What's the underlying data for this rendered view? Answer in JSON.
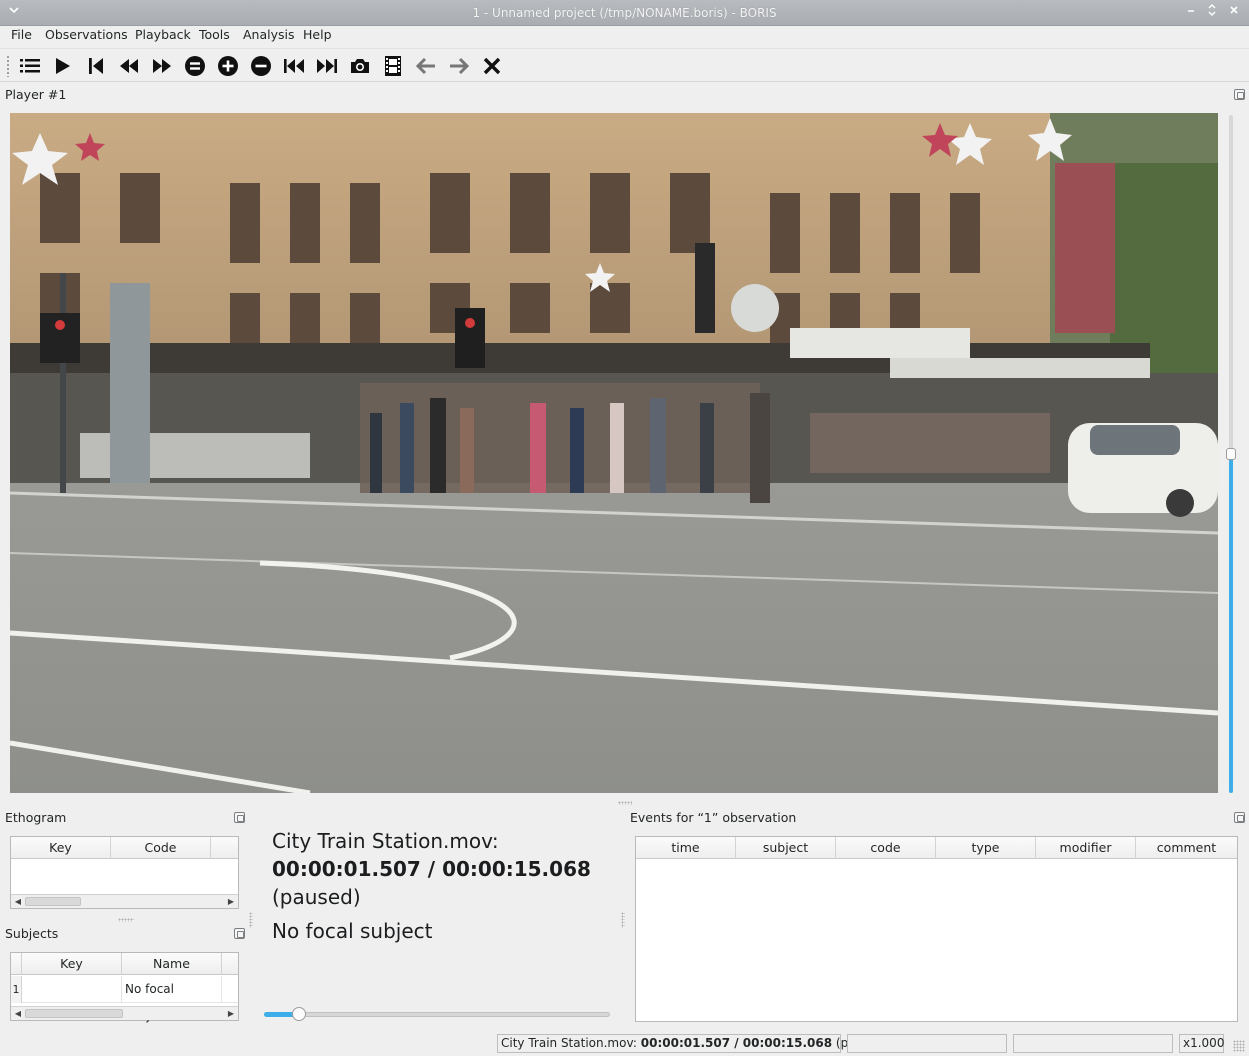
{
  "window": {
    "title": "1 - Unnamed project (/tmp/NONAME.boris) - BORIS",
    "menu_icon": "chevron-down-icon",
    "controls": [
      "minimize-icon",
      "maximize-icon",
      "close-icon"
    ]
  },
  "menu": [
    "File",
    "Observations",
    "Playback",
    "Tools",
    "Analysis",
    "Help"
  ],
  "toolbar": {
    "buttons": [
      {
        "name": "list-icon"
      },
      {
        "name": "play-icon"
      },
      {
        "name": "skip-to-start-icon"
      },
      {
        "name": "rewind-icon"
      },
      {
        "name": "fast-forward-icon"
      },
      {
        "name": "reset-speed-icon"
      },
      {
        "name": "zoom-in-plus-icon"
      },
      {
        "name": "zoom-out-minus-icon"
      },
      {
        "name": "previous-media-icon"
      },
      {
        "name": "next-media-icon"
      },
      {
        "name": "camera-icon"
      },
      {
        "name": "film-strip-icon"
      },
      {
        "name": "arrow-left-icon"
      },
      {
        "name": "arrow-right-icon"
      },
      {
        "name": "close-x-icon"
      }
    ]
  },
  "player": {
    "title": "Player #1",
    "volume_fraction": 0.5
  },
  "ethogram": {
    "title": "Ethogram",
    "columns": [
      "Key",
      "Code"
    ]
  },
  "subjects": {
    "title": "Subjects",
    "columns": [
      "Key",
      "Name"
    ],
    "rows": [
      {
        "num": "1",
        "key": "",
        "name": "No focal subject"
      }
    ]
  },
  "info": {
    "media_name": "City Train Station.mov:",
    "time": "00:00:01.507 / 00:00:15.068",
    "state": "(paused)",
    "focal": "No focal subject",
    "position_fraction": 0.1
  },
  "events": {
    "title": "Events for “1” observation",
    "columns": [
      "time",
      "subject",
      "code",
      "type",
      "modifier",
      "comment"
    ]
  },
  "status": {
    "media_prefix": "City Train Station.mov: ",
    "time": "00:00:01.507 / 00:00:15.068",
    "state": " (paused)",
    "speed": "x1.000"
  }
}
